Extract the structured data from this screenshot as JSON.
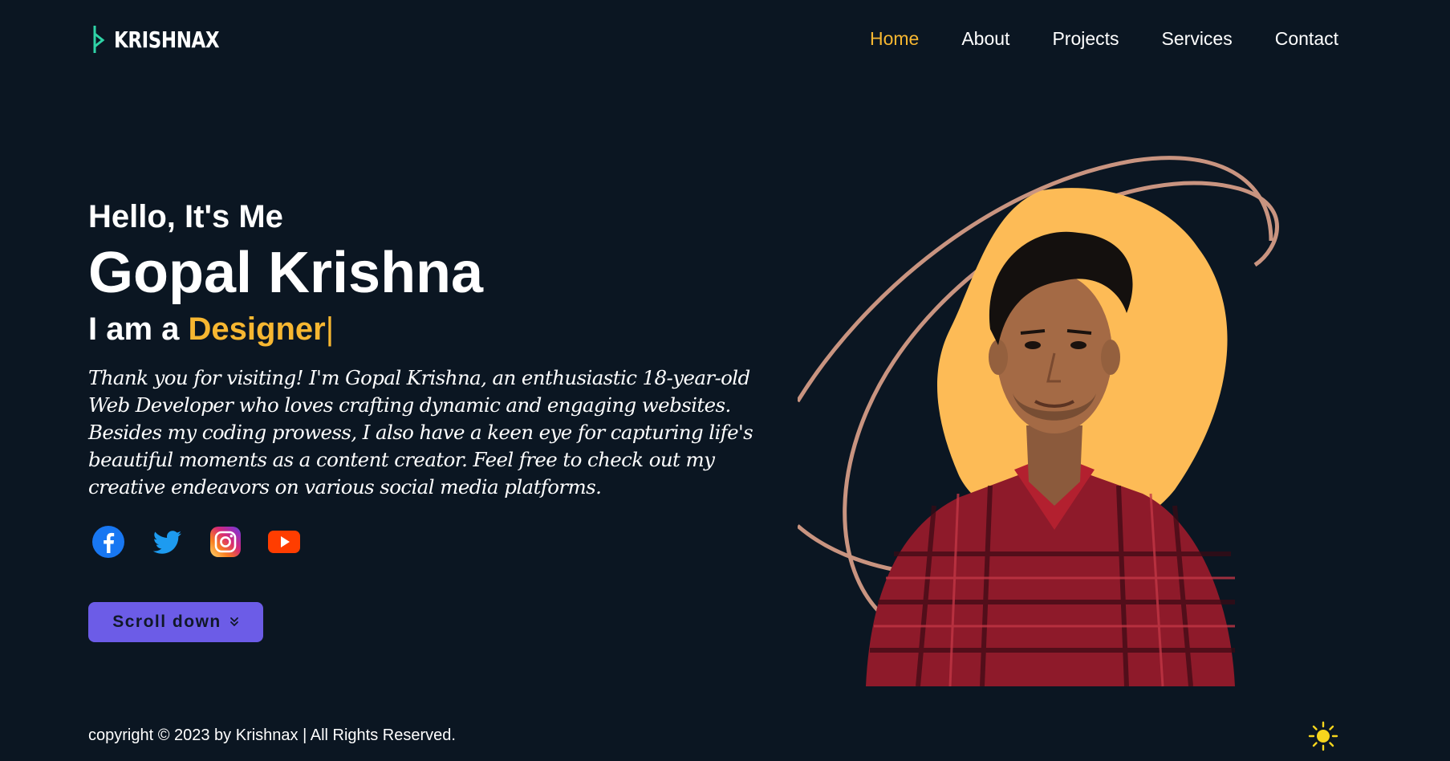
{
  "header": {
    "logo_text": "KRISHNAX",
    "nav": [
      {
        "label": "Home",
        "active": true
      },
      {
        "label": "About",
        "active": false
      },
      {
        "label": "Projects",
        "active": false
      },
      {
        "label": "Services",
        "active": false
      },
      {
        "label": "Contact",
        "active": false
      }
    ]
  },
  "hero": {
    "greeting": "Hello, It's Me",
    "name": "Gopal Krishna",
    "role_prefix": "I am a ",
    "role_highlight": "Designer",
    "role_cursor": "|",
    "bio_line1": "Thank you for visiting! I'm Gopal Krishna, an enthusiastic 18-year-old Web Developer who loves crafting dynamic and engaging websites.",
    "bio_line2": "Besides my coding prowess, I also have a keen eye for capturing life's beautiful moments as a content creator. Feel free to check out my creative endeavors on various social media platforms.",
    "socials": [
      {
        "icon": "facebook-icon"
      },
      {
        "icon": "twitter-icon"
      },
      {
        "icon": "instagram-icon"
      },
      {
        "icon": "youtube-icon"
      }
    ],
    "scroll_button": "Scroll down",
    "scroll_icon": "chevrons-down-icon"
  },
  "footer": {
    "copyright": "copyright © 2023 by Krishnax | All Rights Reserved.",
    "theme_icon": "sun-icon"
  },
  "colors": {
    "background": "#0b1622",
    "accent": "#f7b731",
    "button": "#6c5ce7",
    "blob": "#fdbb56",
    "ring": "#c99480"
  }
}
